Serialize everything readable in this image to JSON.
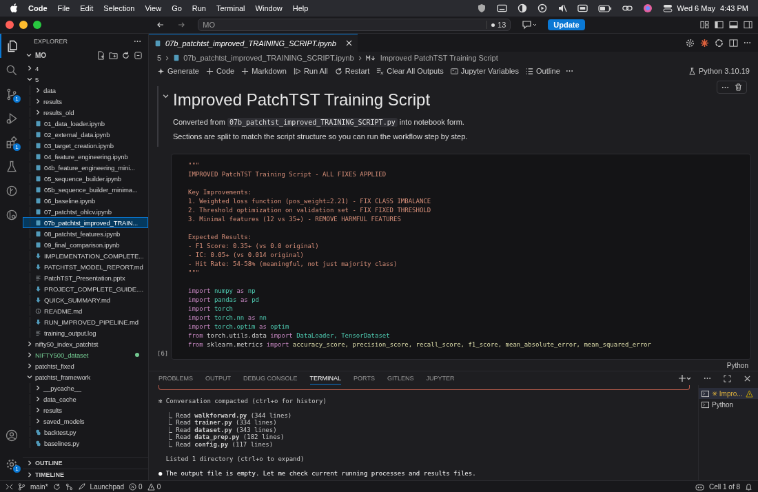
{
  "menubar": {
    "app": "Code",
    "menus": [
      "File",
      "Edit",
      "Selection",
      "View",
      "Go",
      "Run",
      "Terminal",
      "Window",
      "Help"
    ],
    "date": "Wed 6 May",
    "time": "4:43 PM"
  },
  "titlebar": {
    "search": "MO",
    "count": "13",
    "update_button": "Update"
  },
  "activity_bar": {
    "items": [
      {
        "kind": "explorer",
        "selected": true
      },
      {
        "kind": "search",
        "selected": false
      },
      {
        "kind": "scm",
        "selected": false,
        "badge": "1"
      },
      {
        "kind": "debug",
        "selected": false
      },
      {
        "kind": "extensions",
        "selected": false,
        "badge": "1"
      },
      {
        "kind": "testing",
        "selected": false
      },
      {
        "kind": "gitlens",
        "selected": false
      },
      {
        "kind": "remote",
        "selected": false
      }
    ],
    "settings_badge": "1"
  },
  "sidebar": {
    "title": "EXPLORER",
    "root": "MO",
    "tree": [
      {
        "label": "4",
        "kind": "folder",
        "expanded": false,
        "selected": false
      },
      {
        "label": "5",
        "kind": "folder",
        "expanded": true,
        "selected": false,
        "children": [
          {
            "label": "data",
            "kind": "folder",
            "expanded": false,
            "selected": false
          },
          {
            "label": "results",
            "kind": "folder",
            "expanded": false,
            "selected": false
          },
          {
            "label": "results_old",
            "kind": "folder",
            "expanded": false,
            "selected": false
          },
          {
            "label": "01_data_loader.ipynb",
            "kind": "notebook",
            "selected": false
          },
          {
            "label": "02_external_data.ipynb",
            "kind": "notebook",
            "selected": false
          },
          {
            "label": "03_target_creation.ipynb",
            "kind": "notebook",
            "selected": false
          },
          {
            "label": "04_feature_engineering.ipynb",
            "kind": "notebook",
            "selected": false
          },
          {
            "label": "04b_feature_engineering_mini...",
            "kind": "notebook",
            "selected": false
          },
          {
            "label": "05_sequence_builder.ipynb",
            "kind": "notebook",
            "selected": false
          },
          {
            "label": "05b_sequence_builder_minima...",
            "kind": "notebook",
            "selected": false
          },
          {
            "label": "06_baseline.ipynb",
            "kind": "notebook",
            "selected": false
          },
          {
            "label": "07_patchtst_ohlcv.ipynb",
            "kind": "notebook",
            "selected": false
          },
          {
            "label": "07b_patchtst_improved_TRAIN...",
            "kind": "notebook",
            "selected": true
          },
          {
            "label": "08_patchtst_features.ipynb",
            "kind": "notebook",
            "selected": false
          },
          {
            "label": "09_final_comparison.ipynb",
            "kind": "notebook",
            "selected": false
          },
          {
            "label": "IMPLEMENTATION_COMPLETE...",
            "kind": "markdown",
            "selected": false
          },
          {
            "label": "PATCHTST_MODEL_REPORT.md",
            "kind": "markdown",
            "selected": false
          },
          {
            "label": "PatchTST_Presentation.pptx",
            "kind": "text",
            "selected": false
          },
          {
            "label": "PROJECT_COMPLETE_GUIDE....",
            "kind": "markdown",
            "selected": false
          },
          {
            "label": "QUICK_SUMMARY.md",
            "kind": "markdown",
            "selected": false
          },
          {
            "label": "README.md",
            "kind": "info",
            "selected": false
          },
          {
            "label": "RUN_IMPROVED_PIPELINE.md",
            "kind": "markdown",
            "selected": false
          },
          {
            "label": "training_output.log",
            "kind": "text",
            "selected": false
          }
        ]
      },
      {
        "label": "nifty50_index_patchtst",
        "kind": "folder",
        "expanded": false,
        "selected": false
      },
      {
        "label": "NIFTY500_dataset",
        "kind": "folder",
        "expanded": false,
        "selected": false,
        "color": "#73c991"
      },
      {
        "label": "patchtst_fixed",
        "kind": "folder",
        "expanded": false,
        "selected": false
      },
      {
        "label": "patchtst_framework",
        "kind": "folder",
        "expanded": true,
        "selected": false,
        "children": [
          {
            "label": "__pycache__",
            "kind": "folder",
            "expanded": false,
            "selected": false
          },
          {
            "label": "data_cache",
            "kind": "folder",
            "expanded": false,
            "selected": false
          },
          {
            "label": "results",
            "kind": "folder",
            "expanded": false,
            "selected": false
          },
          {
            "label": "saved_models",
            "kind": "folder",
            "expanded": false,
            "selected": false
          },
          {
            "label": "backtest.py",
            "kind": "python",
            "selected": false
          },
          {
            "label": "baselines.py",
            "kind": "python",
            "selected": false
          }
        ]
      }
    ],
    "sections": [
      {
        "label": "OUTLINE",
        "expanded": false
      },
      {
        "label": "TIMELINE",
        "expanded": false
      }
    ]
  },
  "editor": {
    "tab": {
      "label": "07b_patchtst_improved_TRAINING_SCRIPT.ipynb",
      "preview": true
    },
    "breadcrumbs": [
      "5",
      "07b_patchtst_improved_TRAINING_SCRIPT.ipynb",
      "Improved PatchTST Training Script"
    ],
    "toolbar": [
      {
        "label": "Generate",
        "kind": "sparkle"
      },
      {
        "label": "Code",
        "kind": "plus"
      },
      {
        "label": "Markdown",
        "kind": "plus"
      },
      {
        "label": "Run All",
        "kind": "run"
      },
      {
        "label": "Restart",
        "kind": "restart"
      },
      {
        "label": "Clear All Outputs",
        "kind": "clear"
      },
      {
        "label": "Jupyter Variables",
        "kind": "variables"
      },
      {
        "label": "Outline",
        "kind": "outline"
      }
    ],
    "kernel": "Python 3.10.19",
    "markdown_cell": {
      "heading": "Improved PatchTST Training Script",
      "paragraphs": [
        {
          "before": "Converted from ",
          "code": "07b_patchtst_improved_TRAINING_SCRIPT.py",
          "after": " into notebook form."
        },
        {
          "before": "Sections are split to match the script structure so you can run the workflow step by step."
        }
      ]
    },
    "code_cell": {
      "execution_count": "[6]",
      "language": "Python",
      "lines": [
        {
          "kind": "doc",
          "text": "\"\"\""
        },
        {
          "kind": "doc",
          "text": "IMPROVED PatchTST Training Script - ALL FIXES APPLIED"
        },
        {
          "kind": "blank"
        },
        {
          "kind": "doc",
          "text": "Key Improvements:"
        },
        {
          "kind": "doc",
          "text": "1. Weighted loss function (pos_weight=2.21) - FIX CLASS IMBALANCE"
        },
        {
          "kind": "doc",
          "text": "2. Threshold optimization on validation set - FIX FIXED THRESHOLD"
        },
        {
          "kind": "doc",
          "text": "3. Minimal features (12 vs 35+) - REMOVE HARMFUL FEATURES"
        },
        {
          "kind": "blank"
        },
        {
          "kind": "doc",
          "text": "Expected Results:"
        },
        {
          "kind": "doc",
          "text": "- F1 Score: 0.35+ (vs 0.0 original)"
        },
        {
          "kind": "doc",
          "text": "- IC: 0.05+ (vs 0.014 original)"
        },
        {
          "kind": "doc",
          "text": "- Hit Rate: 54-58% (meaningful, not just majority class)"
        },
        {
          "kind": "doc",
          "text": "\"\"\""
        },
        {
          "kind": "blank"
        },
        {
          "kind": "code",
          "tokens": [
            {
              "text": "import",
              "kind": "kw"
            },
            {
              "text": "numpy",
              "kind": "mod"
            },
            {
              "text": "as",
              "kind": "kw"
            },
            {
              "text": "np",
              "kind": "mod"
            }
          ]
        },
        {
          "kind": "code",
          "tokens": [
            {
              "text": "import",
              "kind": "kw"
            },
            {
              "text": "pandas",
              "kind": "mod"
            },
            {
              "text": "as",
              "kind": "kw"
            },
            {
              "text": "pd",
              "kind": "mod"
            }
          ]
        },
        {
          "kind": "code",
          "tokens": [
            {
              "text": "import",
              "kind": "kw"
            },
            {
              "text": "torch",
              "kind": "mod"
            }
          ]
        },
        {
          "kind": "code",
          "tokens": [
            {
              "text": "import",
              "kind": "kw"
            },
            {
              "text": "torch.nn",
              "kind": "mod"
            },
            {
              "text": "as",
              "kind": "kw"
            },
            {
              "text": "nn",
              "kind": "mod"
            }
          ]
        },
        {
          "kind": "code",
          "tokens": [
            {
              "text": "import",
              "kind": "kw"
            },
            {
              "text": "torch.optim",
              "kind": "mod"
            },
            {
              "text": "as",
              "kind": "kw"
            },
            {
              "text": "optim",
              "kind": "mod"
            }
          ]
        },
        {
          "kind": "code",
          "tokens": [
            {
              "text": "from",
              "kind": "kw"
            },
            {
              "text": "torch.utils.data",
              "kind": "plain"
            },
            {
              "text": "import",
              "kind": "kw"
            },
            {
              "text": "DataLoader, TensorDataset",
              "kind": "mod"
            }
          ]
        },
        {
          "kind": "code",
          "tokens": [
            {
              "text": "from",
              "kind": "kw"
            },
            {
              "text": "sklearn.metrics",
              "kind": "plain"
            },
            {
              "text": "import",
              "kind": "kw"
            },
            {
              "text": "accuracy_score, precision_score, recall_score, f1_score, mean_absolute_error, mean_squared_error",
              "kind": "fn"
            }
          ]
        }
      ]
    }
  },
  "panel": {
    "tabs": [
      {
        "label": "PROBLEMS",
        "selected": false
      },
      {
        "label": "OUTPUT",
        "selected": false
      },
      {
        "label": "DEBUG CONSOLE",
        "selected": false
      },
      {
        "label": "TERMINAL",
        "selected": true
      },
      {
        "label": "PORTS",
        "selected": false
      },
      {
        "label": "GITLENS",
        "selected": false
      },
      {
        "label": "JUPYTER",
        "selected": false
      }
    ],
    "terminal_lines": [
      {
        "kind": "blank"
      },
      {
        "kind": "status",
        "text": "✻ Conversation compacted (ctrl+o for history)"
      },
      {
        "kind": "blank"
      },
      {
        "kind": "tool",
        "text": "  ⎿ Read **walkforward.py** (344 lines)"
      },
      {
        "kind": "tool",
        "text": "  ⎿ Read **trainer.py** (334 lines)"
      },
      {
        "kind": "tool",
        "text": "  ⎿ Read **dataset.py** (343 lines)"
      },
      {
        "kind": "tool",
        "text": "  ⎿ Read **data_prep.py** (182 lines)"
      },
      {
        "kind": "tool",
        "text": "  ⎿ Read **config.py** (117 lines)"
      },
      {
        "kind": "blank"
      },
      {
        "kind": "status",
        "text": "  Listed 1 directory (ctrl+o to expand)"
      },
      {
        "kind": "blank"
      },
      {
        "kind": "message",
        "text": "● The output file is empty. Let me check current running processes and results files."
      }
    ],
    "terminals": [
      {
        "label": "✳ Impro...",
        "selected": true,
        "warning": true
      },
      {
        "label": "Python",
        "selected": false,
        "warning": false
      }
    ]
  },
  "status_bar": {
    "branch": "main*",
    "launchpad": "Launchpad",
    "errors": "0",
    "warnings": "0",
    "cell": "Cell 1 of 8"
  }
}
